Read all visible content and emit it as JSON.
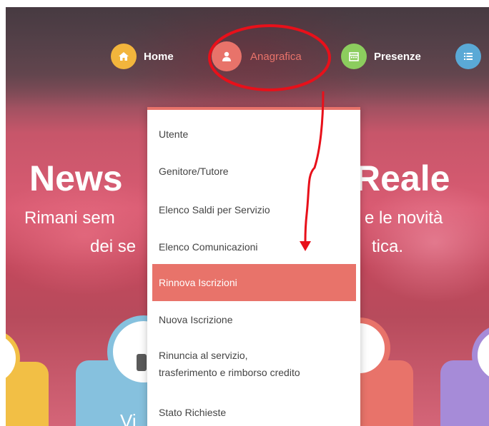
{
  "nav": {
    "items": [
      {
        "label": "Home",
        "color": "#f2b53c",
        "icon": "home-icon"
      },
      {
        "label": "Anagrafica",
        "color": "#e8736a",
        "icon": "user-icon"
      },
      {
        "label": "Presenze",
        "color": "#8ccd5e",
        "icon": "calendar-icon"
      },
      {
        "label": "",
        "color": "#5aa9d6",
        "icon": "list-icon"
      }
    ]
  },
  "hero": {
    "headline_left": "News",
    "headline_right": "Reale",
    "subline1_left": "Rimani sem",
    "subline1_right": "e le novità",
    "subline2_left": "dei se",
    "subline2_right": "tica.",
    "card_partial_text": "Vi"
  },
  "dropdown": {
    "items": [
      {
        "label": "Utente"
      },
      {
        "label": "Genitore/Tutore"
      },
      {
        "label": "Elenco Saldi per Servizio"
      },
      {
        "label": "Elenco Comunicazioni"
      },
      {
        "label": "Rinnova Iscrizioni",
        "active": true
      },
      {
        "label": "Nuova Iscrizione"
      },
      {
        "label_line1": "Rinuncia al servizio,",
        "label_line2": "trasferimento e rimborso credito"
      },
      {
        "label": "Stato Richieste"
      }
    ]
  },
  "colors": {
    "accent": "#e8736a",
    "annotation": "#e8101a",
    "card_yellow": "#f2bf45",
    "card_blue": "#86c1de",
    "card_red": "#e8736a",
    "card_purple": "#a68bd8"
  }
}
